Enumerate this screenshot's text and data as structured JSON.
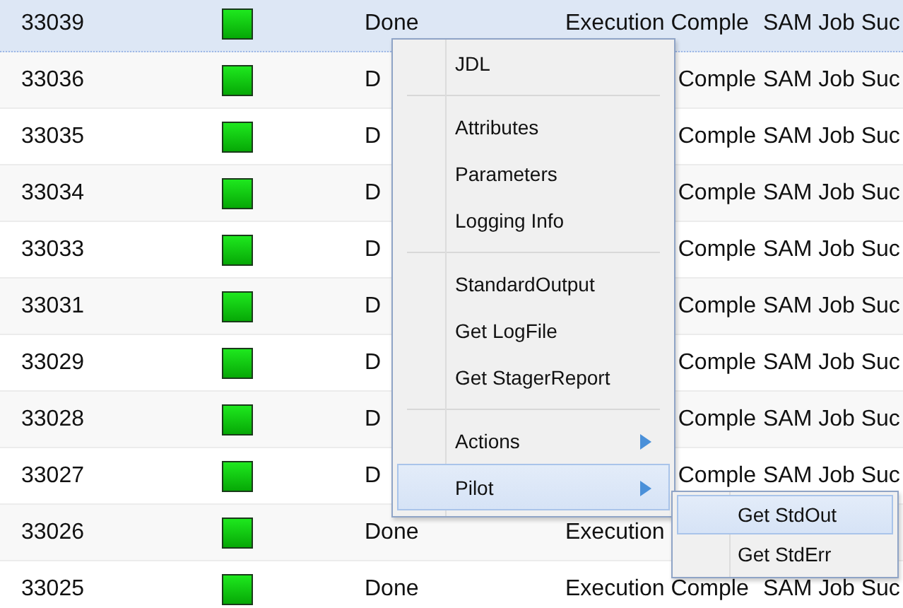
{
  "table": {
    "rows": [
      {
        "kind": "plain",
        "id": "33039",
        "status": "Done",
        "minor_status": "Execution Comple",
        "application_status": "SAM Job Suc",
        "selected": true
      },
      {
        "kind": "covered",
        "id": "33036",
        "status": "D",
        "minor_status": "Comple",
        "application_status": "SAM Job Suc",
        "selected": false
      },
      {
        "kind": "covered",
        "id": "33035",
        "status": "D",
        "minor_status": "Comple",
        "application_status": "SAM Job Suc",
        "selected": false
      },
      {
        "kind": "covered",
        "id": "33034",
        "status": "D",
        "minor_status": "Comple",
        "application_status": "SAM Job Suc",
        "selected": false
      },
      {
        "kind": "covered",
        "id": "33033",
        "status": "D",
        "minor_status": "Comple",
        "application_status": "SAM Job Suc",
        "selected": false
      },
      {
        "kind": "covered",
        "id": "33031",
        "status": "D",
        "minor_status": "Comple",
        "application_status": "SAM Job Suc",
        "selected": false
      },
      {
        "kind": "covered",
        "id": "33029",
        "status": "D",
        "minor_status": "Comple",
        "application_status": "SAM Job Suc",
        "selected": false
      },
      {
        "kind": "covered",
        "id": "33028",
        "status": "D",
        "minor_status": "Comple",
        "application_status": "SAM Job Suc",
        "selected": false
      },
      {
        "kind": "covered",
        "id": "33027",
        "status": "D",
        "minor_status": "Comple",
        "application_status": "SAM Job Suc",
        "selected": false
      },
      {
        "kind": "plain",
        "id": "33026",
        "status": "Done",
        "minor_status": "Execution",
        "selected": false
      },
      {
        "kind": "plain",
        "id": "33025",
        "status": "Done",
        "minor_status": "Execution Comple",
        "application_status": "SAM Job Suc",
        "selected": false
      }
    ]
  },
  "context_menu": {
    "items": [
      {
        "kind": "item",
        "label": "JDL",
        "has_submenu": false,
        "selected": false
      },
      {
        "kind": "separator"
      },
      {
        "kind": "item",
        "label": "Attributes",
        "has_submenu": false,
        "selected": false
      },
      {
        "kind": "item",
        "label": "Parameters",
        "has_submenu": false,
        "selected": false
      },
      {
        "kind": "item",
        "label": "Logging Info",
        "has_submenu": false,
        "selected": false
      },
      {
        "kind": "separator"
      },
      {
        "kind": "item",
        "label": "StandardOutput",
        "has_submenu": false,
        "selected": false
      },
      {
        "kind": "item",
        "label": "Get LogFile",
        "has_submenu": false,
        "selected": false
      },
      {
        "kind": "item",
        "label": "Get StagerReport",
        "has_submenu": false,
        "selected": false
      },
      {
        "kind": "separator"
      },
      {
        "kind": "item",
        "label": "Actions",
        "has_submenu": true,
        "selected": false
      },
      {
        "kind": "item",
        "label": "Pilot",
        "has_submenu": true,
        "selected": true
      }
    ]
  },
  "submenu": {
    "items": [
      {
        "label": "Get StdOut",
        "selected": true
      },
      {
        "label": "Get StdErr",
        "selected": false
      }
    ]
  }
}
